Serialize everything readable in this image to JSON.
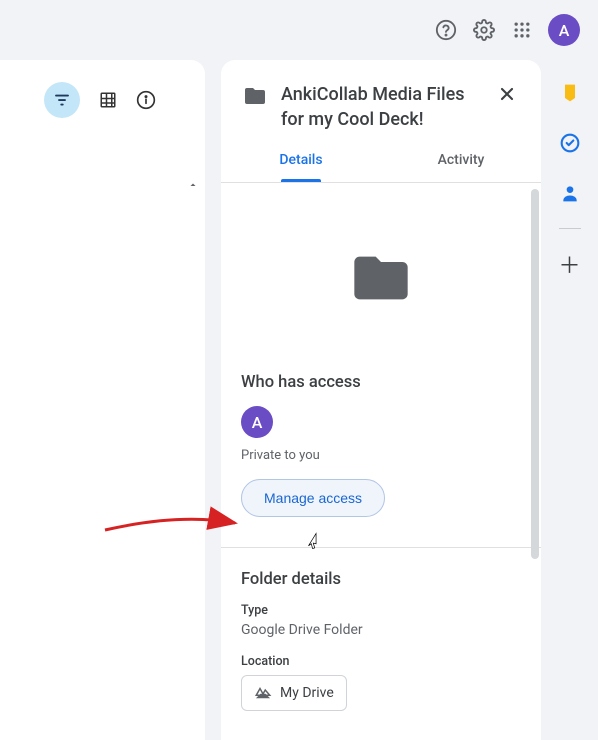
{
  "header": {
    "avatar_letter": "A"
  },
  "details_panel": {
    "title": "AnkiCollab Media Files for my Cool Deck!",
    "tabs": {
      "details": "Details",
      "activity": "Activity"
    },
    "access": {
      "title": "Who has access",
      "owner_letter": "A",
      "status": "Private to you",
      "manage_btn": "Manage access"
    },
    "folder_details": {
      "title": "Folder details",
      "type_label": "Type",
      "type_value": "Google Drive Folder",
      "location_label": "Location",
      "location_chip": "My Drive"
    }
  }
}
